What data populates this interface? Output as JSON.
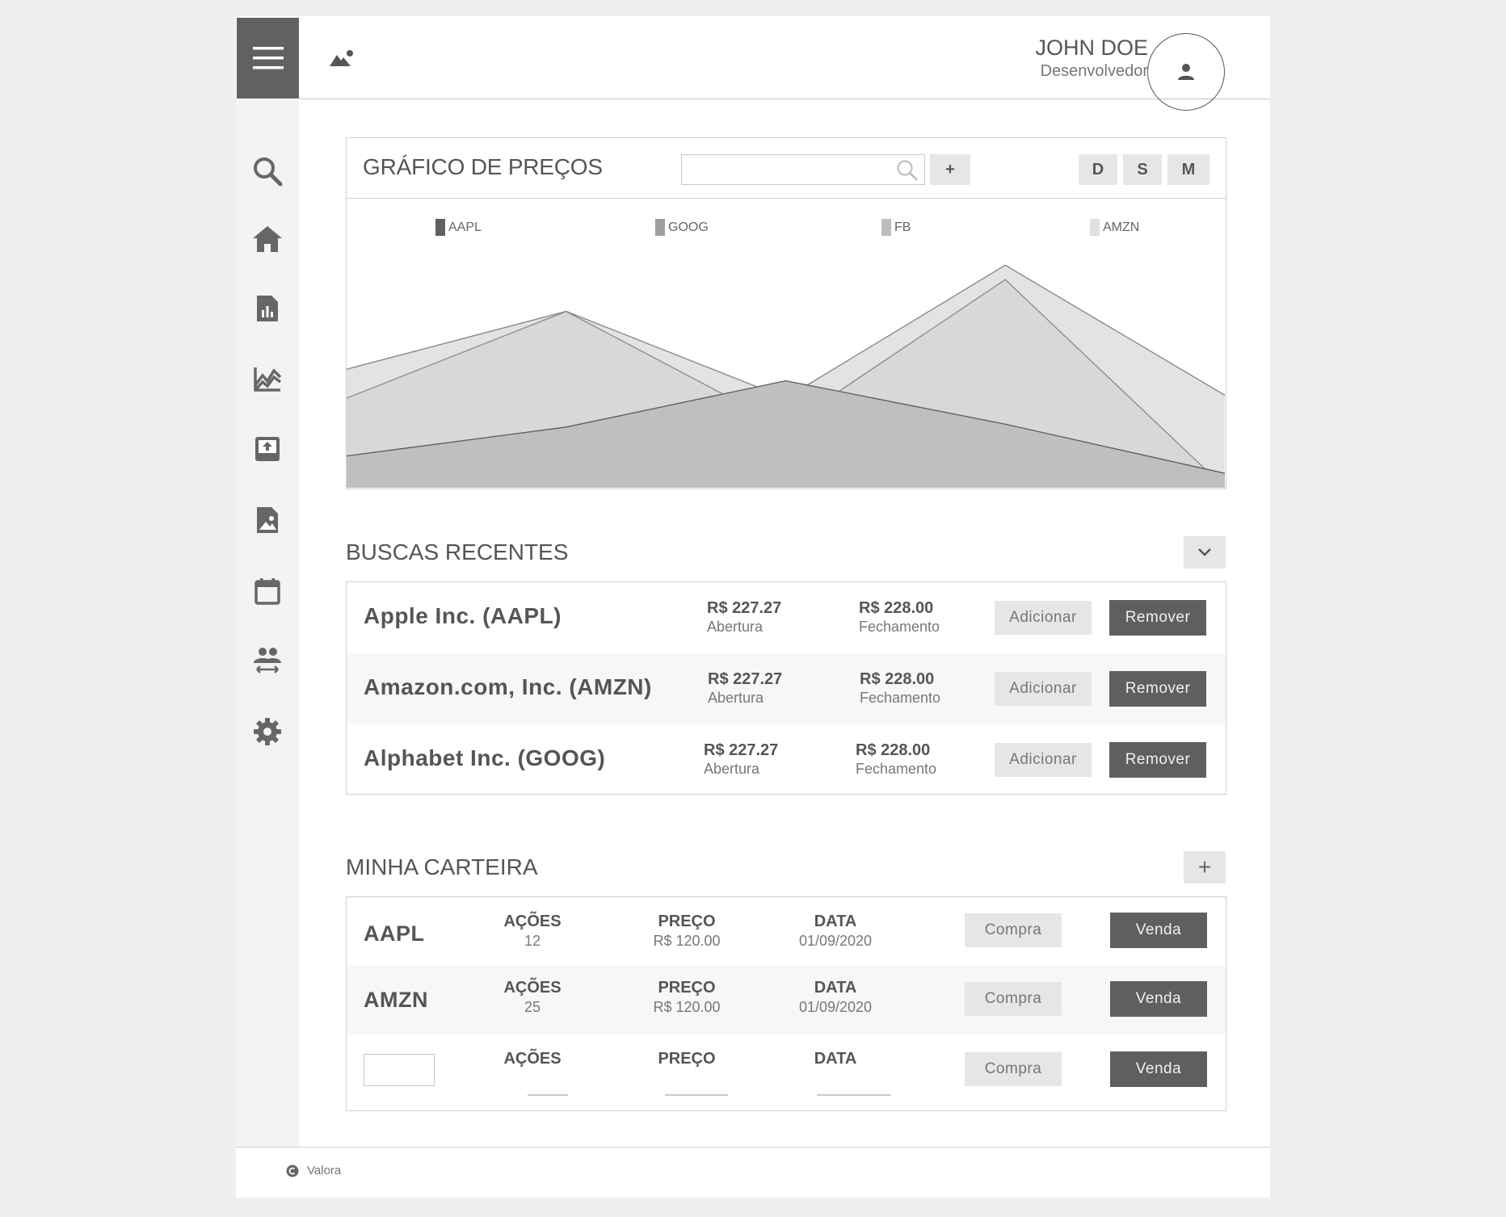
{
  "header": {
    "user_name": "JOHN DOE",
    "user_role": "Desenvolvedor"
  },
  "sidebar": {
    "items": [
      {
        "icon": "search-icon"
      },
      {
        "icon": "home-icon"
      },
      {
        "icon": "report-icon"
      },
      {
        "icon": "chart-icon"
      },
      {
        "icon": "upload-icon"
      },
      {
        "icon": "image-file-icon"
      },
      {
        "icon": "calendar-icon"
      },
      {
        "icon": "people-icon"
      },
      {
        "icon": "gear-icon"
      }
    ]
  },
  "chart_panel": {
    "title": "GRÁFICO DE PREÇOS",
    "search_placeholder": "",
    "add_label": "+",
    "periods": [
      "D",
      "S",
      "M"
    ]
  },
  "chart_data": {
    "type": "area",
    "x": [
      0,
      1,
      2,
      3,
      4
    ],
    "series": [
      {
        "name": "AAPL",
        "color": "#616161",
        "values": [
          11,
          21,
          37,
          22,
          5
        ]
      },
      {
        "name": "GOOG",
        "color": "#9e9e9e",
        "values": [
          31,
          61,
          21,
          72,
          0
        ]
      },
      {
        "name": "FB",
        "color": "#bdbdbd",
        "values": [
          41,
          61,
          31,
          77,
          32
        ]
      },
      {
        "name": "AMZN",
        "color": "#e0e0e0",
        "values": [
          41,
          61,
          31,
          77,
          32
        ]
      }
    ],
    "ylim": [
      0,
      100
    ],
    "grid": false,
    "legend": "top"
  },
  "recent": {
    "title": "BUSCAS RECENTES",
    "open_label": "R$ 227.27",
    "open_caption": "Abertura",
    "close_label": "R$ 228.00",
    "close_caption": "Fechamento",
    "add_button": "Adicionar",
    "remove_button": "Remover",
    "rows": [
      {
        "name": "Apple Inc. (AAPL)"
      },
      {
        "name": "Amazon.com, Inc. (AMZN)"
      },
      {
        "name": "Alphabet Inc. (GOOG)"
      }
    ]
  },
  "portfolio": {
    "title": "MINHA CARTEIRA",
    "add_label": "+",
    "col_shares": "AÇÕES",
    "col_price": "PREÇO",
    "col_date": "DATA",
    "buy_button": "Compra",
    "sell_button": "Venda",
    "rows": [
      {
        "ticker": "AAPL",
        "shares": "12",
        "price": "R$ 120.00",
        "date": "01/09/2020"
      },
      {
        "ticker": "AMZN",
        "shares": "25",
        "price": "R$ 120.00",
        "date": "01/09/2020"
      }
    ]
  },
  "footer": {
    "brand": "Valora"
  }
}
